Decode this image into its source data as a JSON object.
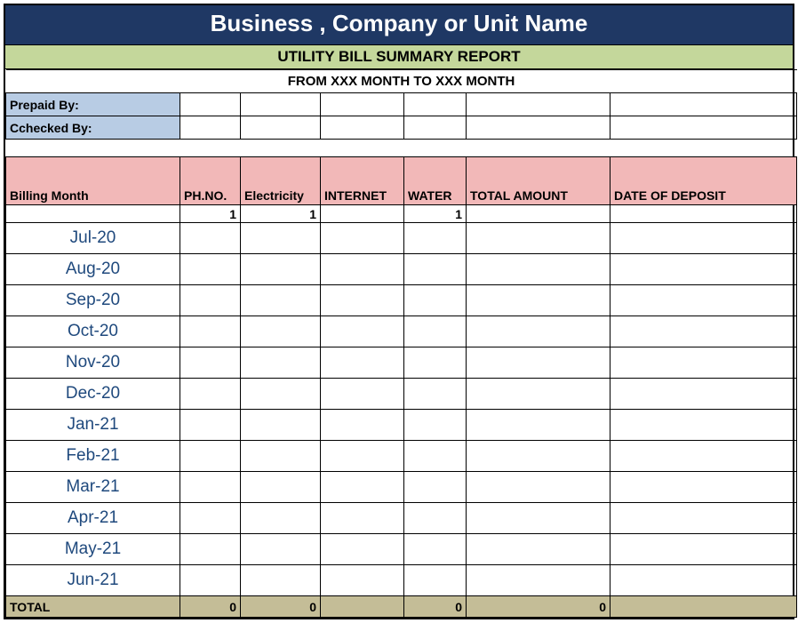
{
  "title": "Business , Company or Unit Name",
  "subtitle": "UTILITY BILL SUMMARY REPORT",
  "period": "FROM XXX MONTH  TO XXX MONTH",
  "meta": {
    "prepaid_label": "Prepaid By:",
    "checked_label": "Cchecked By:"
  },
  "columns": {
    "billing_month": "Billing Month",
    "ph_no": "PH.NO.",
    "electricity": "Electricity",
    "internet": "INTERNET",
    "water": "WATER",
    "total_amount": "TOTAL AMOUNT",
    "date_of_deposit": "DATE OF DEPOSIT"
  },
  "under_header": {
    "ph_no": "1",
    "electricity": "1",
    "water": "1"
  },
  "months": [
    "Jul-20",
    "Aug-20",
    "Sep-20",
    "Oct-20",
    "Nov-20",
    "Dec-20",
    "Jan-21",
    "Feb-21",
    "Mar-21",
    "Apr-21",
    "May-21",
    "Jun-21"
  ],
  "totals": {
    "label": "TOTAL",
    "ph_no": "0",
    "electricity": "0",
    "water": "0",
    "total_amount": "0"
  }
}
